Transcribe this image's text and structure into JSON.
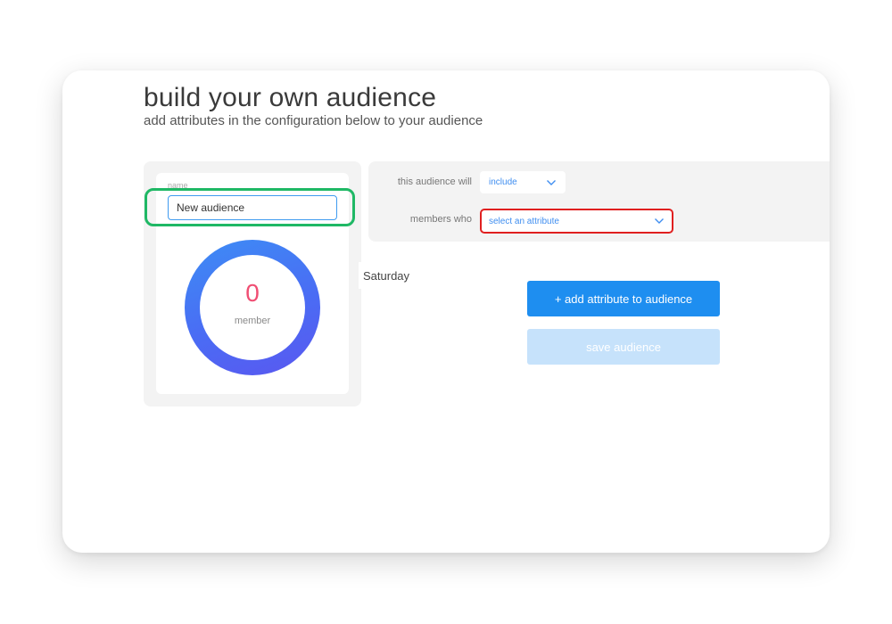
{
  "header": {
    "title": "build your own audience",
    "subtitle": "add attributes in the configuration below to your audience"
  },
  "audience": {
    "name_label": "name",
    "name_value": "New audience",
    "member_count": "0",
    "member_label": "member"
  },
  "rules": {
    "will_label": "this audience will",
    "will_value": "include",
    "members_label": "members who",
    "attribute_placeholder": "select an attribute"
  },
  "tooltip": {
    "text": "Saturday"
  },
  "actions": {
    "add_attribute_label": "+ add attribute to audience",
    "save_label": "save audience"
  },
  "colors": {
    "accent": "#1e8ef0",
    "count": "#f04e73",
    "highlight_green": "#1fb865",
    "highlight_red": "#e02020"
  }
}
